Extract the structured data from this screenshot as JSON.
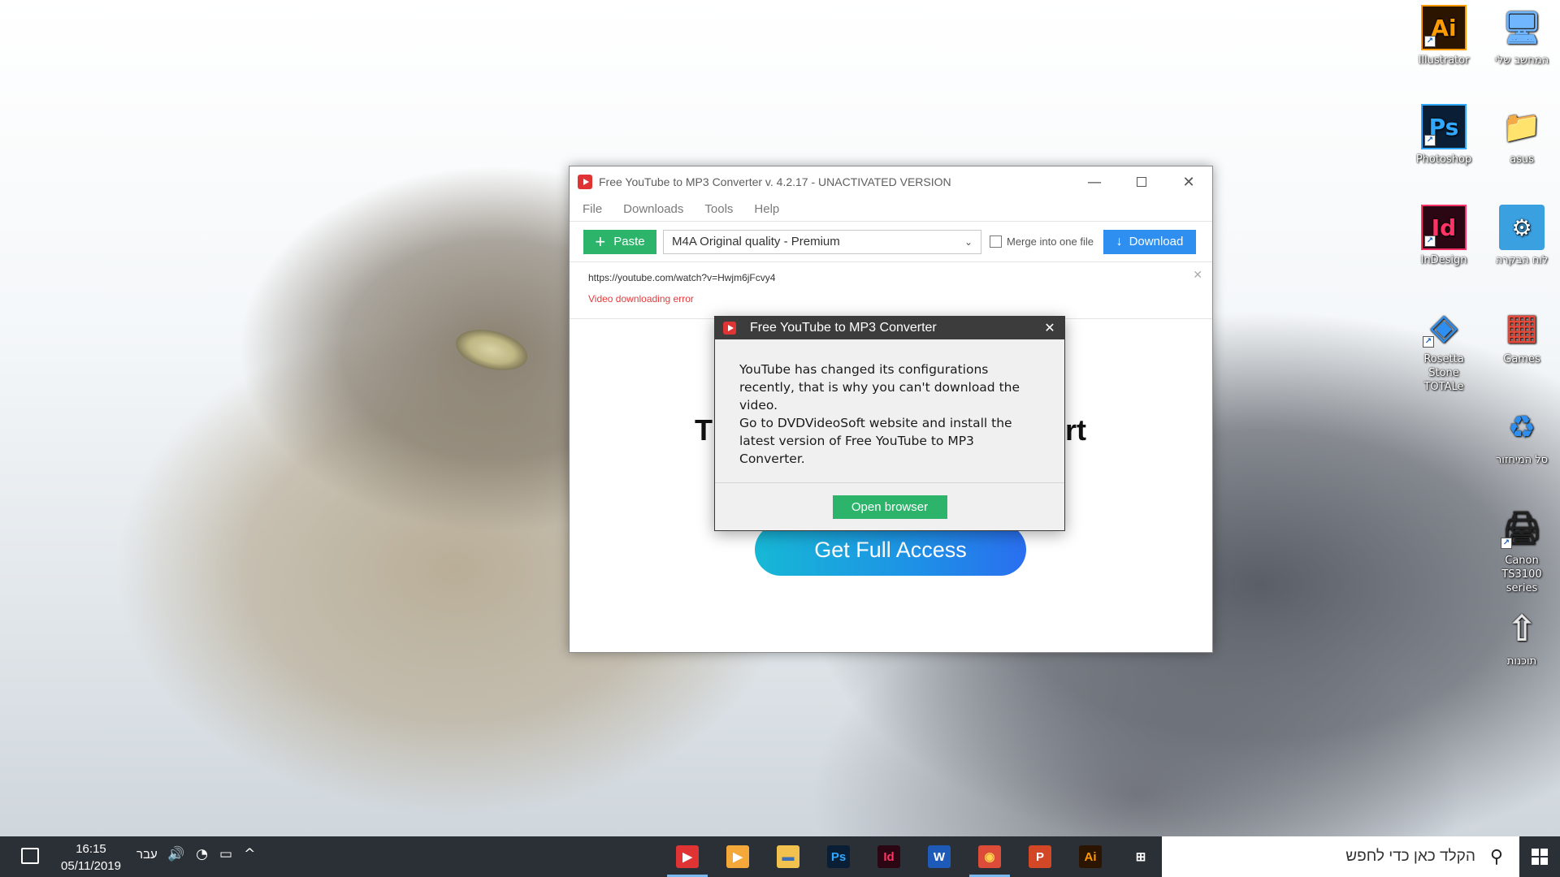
{
  "desktop": {
    "icons": [
      {
        "label": "Illustrator",
        "glyph": "Ai"
      },
      {
        "label": "המחשב שלי",
        "glyph": "🖥"
      },
      {
        "label": "Photoshop",
        "glyph": "Ps"
      },
      {
        "label": "asus",
        "glyph": "📁"
      },
      {
        "label": "InDesign",
        "glyph": "Id"
      },
      {
        "label": "לוח הבקרה",
        "glyph": "⚙"
      },
      {
        "label": "Rosetta Stone TOTALe",
        "glyph": "◈"
      },
      {
        "label": "Games",
        "glyph": "▦"
      },
      {
        "label": "סל המיחזור",
        "glyph": "♻"
      },
      {
        "label": "Canon TS3100 series",
        "glyph": "🖨"
      },
      {
        "label": "תוכנות",
        "glyph": "⇧"
      }
    ]
  },
  "app": {
    "title": "Free YouTube to MP3 Converter v. 4.2.17 - UNACTIVATED VERSION",
    "menu": [
      "File",
      "Downloads",
      "Tools",
      "Help"
    ],
    "toolbar": {
      "paste_label": "Paste",
      "format_value": "M4A Original quality - Premium",
      "merge_label": "Merge into one file",
      "download_label": "Download"
    },
    "download_item": {
      "url": "https://youtube.com/watch?v=Hwjm6jFcvy4",
      "error": "Video downloading error"
    },
    "promo": {
      "headline_left": "T",
      "headline_right": "rt",
      "button_label": "Get Full Access"
    }
  },
  "dialog": {
    "title": "Free YouTube to MP3 Converter",
    "message_lines": [
      "YouTube has changed its configurations",
      "recently, that is why you can't download the",
      "video.",
      "Go to DVDVideoSoft website and install the",
      "latest version of Free YouTube to MP3",
      "Converter."
    ],
    "button_label": "Open browser"
  },
  "taskbar": {
    "time": "16:15",
    "date": "05/11/2019",
    "language": "עבר",
    "search_placeholder": "הקלד כאן כדי לחפש",
    "apps": [
      {
        "name": "youtube-mp3",
        "glyph": "▶",
        "bg": "#e03434",
        "fg": "#ffffff",
        "active": true
      },
      {
        "name": "media-player",
        "glyph": "▶",
        "bg": "#f4a83a",
        "fg": "#ffffff",
        "active": false
      },
      {
        "name": "file-explorer",
        "glyph": "▬",
        "bg": "#f2c14e",
        "fg": "#3c6fb6",
        "active": false
      },
      {
        "name": "photoshop",
        "glyph": "Ps",
        "bg": "#0a1f36",
        "fg": "#31a8ff",
        "active": false
      },
      {
        "name": "indesign",
        "glyph": "Id",
        "bg": "#2a0713",
        "fg": "#ff3366",
        "active": false
      },
      {
        "name": "word",
        "glyph": "W",
        "bg": "#1e5bb8",
        "fg": "#ffffff",
        "active": false
      },
      {
        "name": "chrome",
        "glyph": "◉",
        "bg": "#dd4b39",
        "fg": "#ffd24d",
        "active": true
      },
      {
        "name": "powerpoint",
        "glyph": "P",
        "bg": "#d24726",
        "fg": "#ffffff",
        "active": false
      },
      {
        "name": "illustrator",
        "glyph": "Ai",
        "bg": "#2b1400",
        "fg": "#ff9a00",
        "active": false
      },
      {
        "name": "task-view",
        "glyph": "⊞",
        "bg": "transparent",
        "fg": "#ffffff",
        "active": false
      }
    ]
  },
  "colors": {
    "accent_green": "#2cb46b",
    "accent_blue": "#2f8ff0",
    "error_red": "#e53a3a",
    "taskbar": "#2b3036"
  }
}
